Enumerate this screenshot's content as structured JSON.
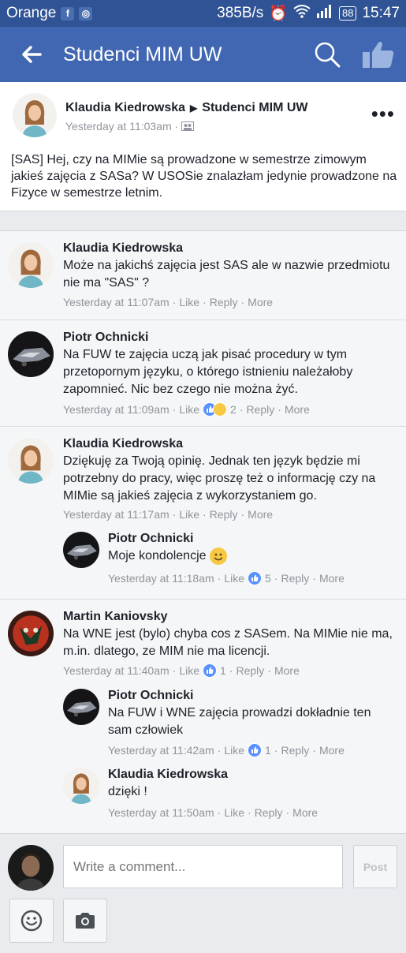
{
  "statusbar": {
    "carrier": "Orange",
    "speed": "385B/s",
    "battery": "88",
    "time": "15:47"
  },
  "header": {
    "title": "Studenci MIM UW"
  },
  "post": {
    "author": "Klaudia Kiedrowska",
    "group": "Studenci MIM UW",
    "time": "Yesterday at 11:03am ·",
    "text": "[SAS] Hej, czy na MIMie są prowadzone w semestrze zimowym jakieś zajęcia z SASa? W USOSie znalazłam jedynie prowadzone na Fizyce w semestrze letnim."
  },
  "actions": {
    "like": "Like",
    "reply": "Reply",
    "more": "More",
    "sep": "·"
  },
  "comments": [
    {
      "author": "Klaudia Kiedrowska",
      "text": "Może na jakichś zajęcia jest SAS ale w nazwie przedmiotu nie ma \"SAS\" ?",
      "time": "Yesterday at 11:07am"
    },
    {
      "author": "Piotr Ochnicki",
      "text": "Na FUW te zajęcia uczą jak pisać procedury w tym przetopornym języku, o którego istnieniu należałoby zapomnieć. Nic bez czego nie można żyć.",
      "time": "Yesterday at 11:09am",
      "reactions": "2"
    },
    {
      "author": "Klaudia Kiedrowska",
      "text": "Dziękuję za Twoją opinię. Jednak ten język będzie mi potrzebny do pracy, więc proszę też o informację czy na MIMie są jakieś zajęcia z wykorzystaniem go.",
      "time": "Yesterday at 11:17am",
      "replies": [
        {
          "author": "Piotr Ochnicki",
          "text": "Moje kondolencje",
          "time": "Yesterday at 11:18am",
          "reactions": "5"
        }
      ]
    },
    {
      "author": "Martin Kaniovsky",
      "text": "Na WNE jest (bylo) chyba cos z SASem. Na MIMie nie ma, m.in. dlatego, ze MIM nie ma licencji.",
      "time": "Yesterday at 11:40am",
      "reactions": "1",
      "replies": [
        {
          "author": "Piotr Ochnicki",
          "text": "Na FUW i WNE zajęcia prowadzi dokładnie ten sam człowiek",
          "time": "Yesterday at 11:42am",
          "reactions": "1"
        },
        {
          "author": "Klaudia Kiedrowska",
          "text": "dzięki !",
          "time": "Yesterday at 11:50am"
        }
      ]
    }
  ],
  "composer": {
    "placeholder": "Write a comment...",
    "post_label": "Post"
  },
  "colors": {
    "brand": "#4267b2",
    "status": "#2f5394",
    "reaction_like": "#5890ff"
  }
}
